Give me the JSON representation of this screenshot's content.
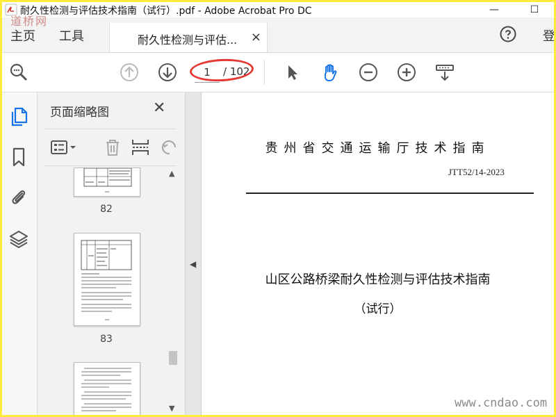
{
  "window": {
    "title": "耐久性检测与评估技术指南（试行）.pdf - Adobe Acrobat Pro DC",
    "minimize": "—",
    "maximize": "☐"
  },
  "tabs": {
    "home": "主页",
    "tools": "工具",
    "document": "耐久性检测与评估...",
    "close": "×",
    "signin": "登"
  },
  "toolbar": {
    "page_current": "1",
    "page_total": "/ 102"
  },
  "thumbnails": {
    "title": "页面缩略图",
    "close": "✕",
    "pages": [
      "82",
      "83"
    ]
  },
  "document": {
    "heading": "贵州省交通运输厅技术指南",
    "code": "JTT52/14-2023",
    "title": "山区公路桥梁耐久性检测与评估技术指南",
    "subtitle": "（试行）"
  },
  "watermarks": {
    "top": "道桥网",
    "bottom": "www.cndao.com"
  },
  "colors": {
    "accent": "#1473e6",
    "annotation": "#e53935",
    "frame": "#ffeb3b"
  }
}
